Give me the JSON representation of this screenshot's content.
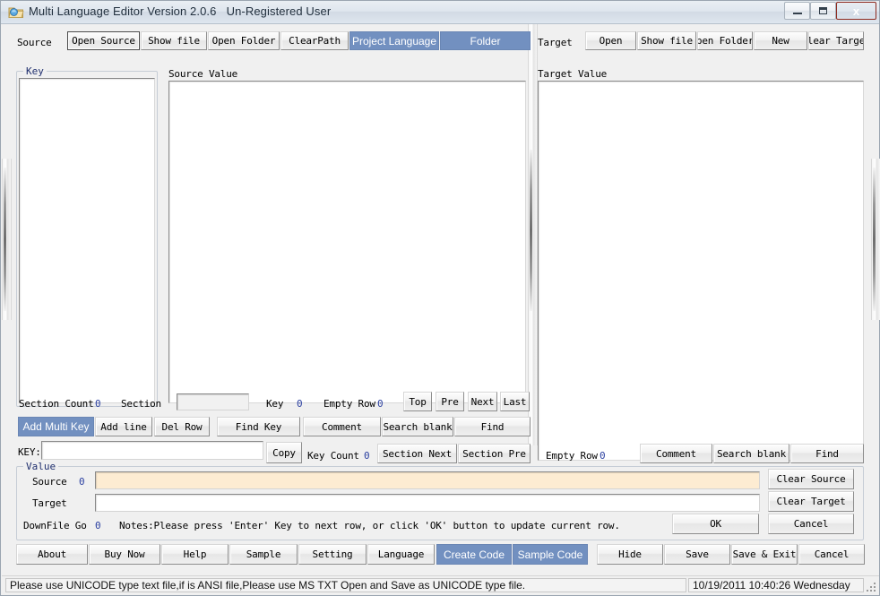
{
  "window": {
    "title": "Multi Language Editor Version 2.0.6   Un-Registered User",
    "icon": "app-folder-icon",
    "minimize_label": "minimize",
    "maximize_label": "maximize",
    "close_label": "x"
  },
  "colors": {
    "accent_blue": "#7290c0",
    "value_number": "#2a3fa0",
    "source_field_bg": "#fdecd2",
    "close_button": "#c8362a"
  },
  "source_toolbar": {
    "label": "Source",
    "buttons": [
      {
        "label": "Open Source",
        "style": "focus",
        "name": "open-source-button"
      },
      {
        "label": "Show file",
        "style": "normal",
        "name": "show-file-source-button"
      },
      {
        "label": "Open Folder",
        "style": "normal",
        "name": "open-folder-source-button"
      },
      {
        "label": "ClearPath",
        "style": "normal",
        "name": "clear-path-button"
      },
      {
        "label": "Project Language",
        "style": "blue",
        "name": "project-language-button"
      },
      {
        "label": "Folder",
        "style": "blue",
        "name": "folder-button"
      }
    ]
  },
  "target_toolbar": {
    "label": "Target",
    "buttons": [
      {
        "label": "Open",
        "style": "normal",
        "name": "open-target-button"
      },
      {
        "label": "Show file",
        "style": "normal",
        "name": "show-file-target-button"
      },
      {
        "label": "pen Folder",
        "style": "normal",
        "name": "open-folder-target-button"
      },
      {
        "label": "New",
        "style": "normal",
        "name": "new-target-button"
      },
      {
        "label": "lear Targe",
        "style": "normal",
        "name": "clear-target-top-button"
      }
    ]
  },
  "panels": {
    "key_group_label": "Key",
    "key_list_value": "",
    "source_value_label": "Source Value",
    "source_value_text": "",
    "target_value_label": "Target Value",
    "target_value_text": ""
  },
  "source_status": {
    "section_count_label": "Section Count",
    "section_count_value": "0",
    "section_label": "Section",
    "section_input_value": "",
    "key_label": "Key",
    "key_value": "0",
    "empty_row_label": "Empty Row",
    "empty_row_value": "0",
    "nav_buttons": [
      {
        "label": "Top",
        "name": "nav-top-button"
      },
      {
        "label": "Pre",
        "name": "nav-pre-button"
      },
      {
        "label": "Next",
        "name": "nav-next-button"
      },
      {
        "label": "Last",
        "name": "nav-last-button"
      }
    ]
  },
  "source_actions": [
    {
      "label": "Add Multi Key",
      "style": "blue",
      "name": "add-multi-key-button"
    },
    {
      "label": "Add line",
      "style": "normal",
      "name": "add-line-button"
    },
    {
      "label": "Del Row",
      "style": "normal",
      "name": "del-row-button"
    },
    {
      "label": "Find Key",
      "style": "normal",
      "name": "find-key-button"
    },
    {
      "label": "Comment",
      "style": "normal",
      "name": "comment-source-button"
    },
    {
      "label": "Search blank",
      "style": "normal",
      "name": "search-blank-source-button"
    },
    {
      "label": "Find",
      "style": "normal",
      "name": "find-source-button"
    }
  ],
  "key_row": {
    "key_label": "KEY:",
    "key_input_value": "",
    "copy_label": "Copy",
    "key_count_label": "Key Count",
    "key_count_value": "0",
    "section_next_label": "Section Next",
    "section_pre_label": "Section Pre"
  },
  "target_status": {
    "empty_row_label": "Empty Row",
    "empty_row_value": "0",
    "comment_label": "Comment",
    "search_blank_label": "Search blank",
    "find_label": "Find"
  },
  "value_group": {
    "group_label": "Value",
    "source_label": "Source",
    "source_index": "0",
    "source_input_value": "",
    "target_label": "Target",
    "target_input_value": "",
    "downfile_label": "DownFile Go",
    "downfile_value": "0",
    "notes": "Notes:Please press 'Enter' Key to next row, or click 'OK' button to update current row.",
    "clear_source_label": "Clear Source",
    "clear_target_label": "Clear Target",
    "ok_label": "OK",
    "cancel_label": "Cancel"
  },
  "bottom_bar": [
    {
      "label": "About",
      "style": "normal",
      "name": "about-button"
    },
    {
      "label": "Buy Now",
      "style": "normal",
      "name": "buy-now-button"
    },
    {
      "label": "Help",
      "style": "normal",
      "name": "help-button"
    },
    {
      "label": "Sample",
      "style": "normal",
      "name": "sample-button"
    },
    {
      "label": "Setting",
      "style": "normal",
      "name": "setting-button"
    },
    {
      "label": "Language",
      "style": "normal",
      "name": "language-button"
    },
    {
      "label": "Create Code",
      "style": "blue",
      "name": "create-code-button"
    },
    {
      "label": "Sample Code",
      "style": "blue",
      "name": "sample-code-button"
    },
    {
      "label": "Hide",
      "style": "normal",
      "name": "hide-button"
    },
    {
      "label": "Save",
      "style": "normal",
      "name": "save-button"
    },
    {
      "label": "Save & Exit",
      "style": "normal",
      "name": "save-exit-button"
    },
    {
      "label": "Cancel",
      "style": "normal",
      "name": "cancel-bottom-button"
    }
  ],
  "statusbar": {
    "message": "Please use UNICODE type text file,if is ANSI file,Please use MS TXT Open and Save as UNICODE type file.",
    "datetime": "10/19/2011  10:40:26 Wednesday"
  }
}
